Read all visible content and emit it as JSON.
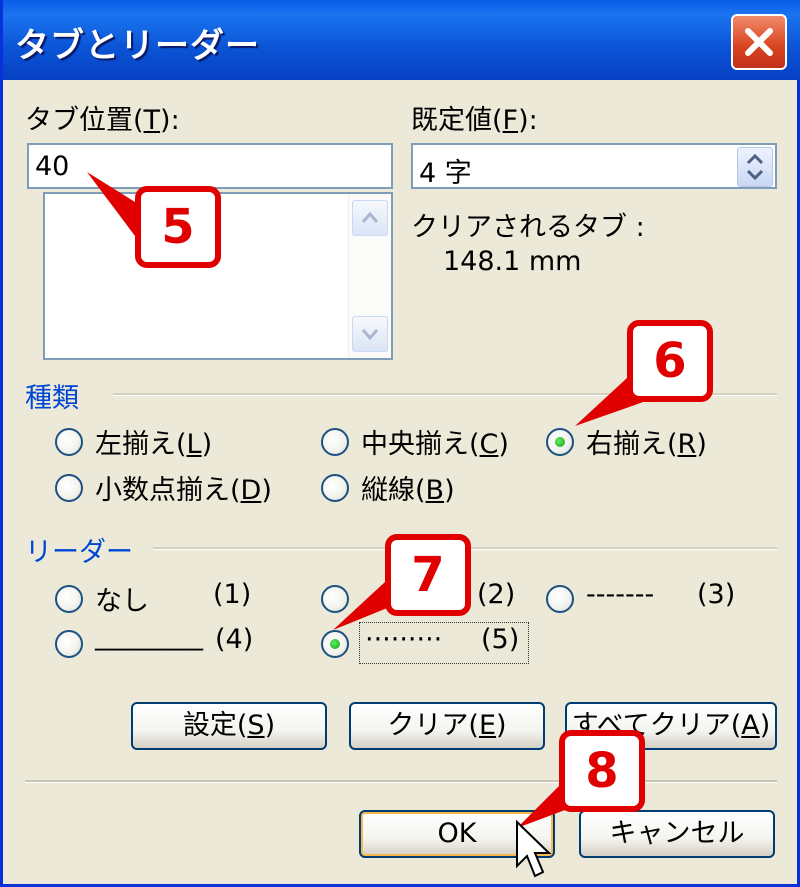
{
  "window": {
    "title": "タブとリーダー"
  },
  "tab_position": {
    "label": "タブ位置(",
    "mnemonic": "T",
    "suffix": "):",
    "value": "40"
  },
  "default_tab": {
    "label": "既定値(",
    "mnemonic": "F",
    "suffix": "):",
    "value": "4 字"
  },
  "clear_info": {
    "label": "クリアされるタブ :",
    "value": "148.1  mm"
  },
  "type_group": {
    "title": "種類",
    "options": [
      {
        "label": "左揃え(",
        "mnemonic": "L",
        "suffix": ")",
        "selected": false
      },
      {
        "label": "中央揃え(",
        "mnemonic": "C",
        "suffix": ")",
        "selected": false
      },
      {
        "label": "右揃え(",
        "mnemonic": "R",
        "suffix": ")",
        "selected": true
      },
      {
        "label": "小数点揃え(",
        "mnemonic": "D",
        "suffix": ")",
        "selected": false
      },
      {
        "label": "縦線(",
        "mnemonic": "B",
        "suffix": ")",
        "selected": false
      }
    ]
  },
  "leader_group": {
    "title": "リーダー",
    "options": [
      {
        "label": "なし",
        "num": "(1)",
        "selected": false
      },
      {
        "label": "",
        "num": "(2)",
        "selected": false
      },
      {
        "label": "-------",
        "num": "(3)",
        "selected": false
      },
      {
        "label": "________",
        "num": "(4)",
        "selected": false
      },
      {
        "label": "·········",
        "num": "(5)",
        "selected": true
      }
    ]
  },
  "buttons": {
    "set": {
      "label": "設定(",
      "mnemonic": "S",
      "suffix": ")"
    },
    "clear": {
      "label": "クリア(",
      "mnemonic": "E",
      "suffix": ")"
    },
    "clear_all": {
      "label": "すべてクリア(",
      "mnemonic": "A",
      "suffix": ")"
    },
    "ok": "OK",
    "cancel": "キャンセル"
  },
  "callouts": [
    "5",
    "6",
    "7",
    "8"
  ],
  "colors": {
    "callout": "#e00000",
    "group_title": "#0046d5",
    "titlebar": "#0a5ce8"
  }
}
